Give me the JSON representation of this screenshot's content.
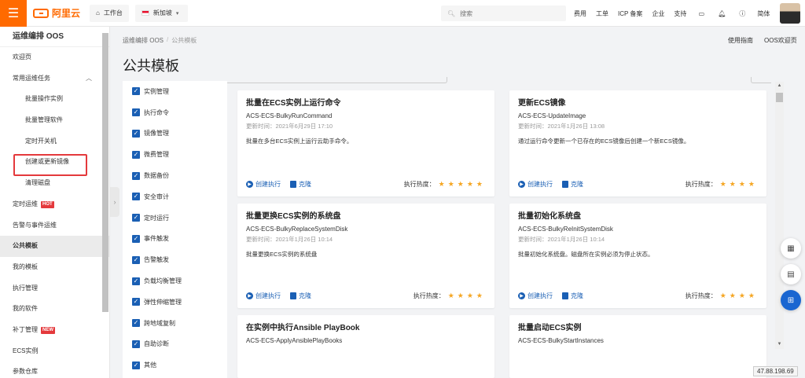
{
  "topbar": {
    "menu_icon": "hamburger-icon",
    "logo_text": "阿里云",
    "workbench": "工作台",
    "region": "新加坡",
    "search_placeholder": "搜索",
    "links": [
      "费用",
      "工单",
      "ICP 备案",
      "企业",
      "支持"
    ],
    "lang": "简体"
  },
  "sidebar": {
    "title": "运维编排 OOS",
    "items": [
      {
        "label": "欢迎页"
      },
      {
        "label": "常用运维任务"
      },
      {
        "label": "批量操作实例"
      },
      {
        "label": "批量管理软件"
      },
      {
        "label": "定时开关机"
      },
      {
        "label": "创建或更新镜像"
      },
      {
        "label": "清理磁盘"
      },
      {
        "label": "定时运维",
        "badge": "HOT"
      },
      {
        "label": "告警与事件运维"
      },
      {
        "label": "公共模板"
      },
      {
        "label": "我的模板"
      },
      {
        "label": "执行管理"
      },
      {
        "label": "我的软件"
      },
      {
        "label": "补丁管理",
        "badge": "NEW"
      },
      {
        "label": "ECS实例"
      },
      {
        "label": "参数仓库"
      }
    ]
  },
  "breadcrumb": {
    "parent": "运维编排 OOS",
    "sep": "/",
    "current": "公共模板"
  },
  "top_links": [
    "使用指南",
    "OOS欢迎页"
  ],
  "page_title": "公共模板",
  "filters": [
    "实例管理",
    "执行命令",
    "镜像管理",
    "微费管理",
    "数据备份",
    "安全审计",
    "定时运行",
    "事件触发",
    "告警触发",
    "负载均衡管理",
    "弹性伸缩管理",
    "跨地域复制",
    "自助诊断",
    "其他"
  ],
  "cards": [
    {
      "title": "批量在ECS实例上运行命令",
      "id": "ACS-ECS-BulkyRunCommand",
      "time": "更新时间：2021年6月29日 17:10",
      "desc": "批量在多台ECS实例上运行云助手命令。",
      "run": "创建执行",
      "clone": "克隆",
      "heat": "执行热度：",
      "stars": 5
    },
    {
      "title": "更新ECS镜像",
      "id": "ACS-ECS-UpdateImage",
      "time": "更新时间：2021年1月26日 13:08",
      "desc": "通过运行命令更新一个已存在的ECS镜像后创建一个新ECS镜像。",
      "run": "创建执行",
      "clone": "克隆",
      "heat": "执行热度：",
      "stars": 4
    },
    {
      "title": "批量更换ECS实例的系统盘",
      "id": "ACS-ECS-BulkyReplaceSystemDisk",
      "time": "更新时间：2021年1月26日 10:14",
      "desc": "批量更换ECS实例的系统盘",
      "run": "创建执行",
      "clone": "克隆",
      "heat": "执行热度：",
      "stars": 4
    },
    {
      "title": "批量初始化系统盘",
      "id": "ACS-ECS-BulkyReInitSystemDisk",
      "time": "更新时间：2021年1月26日 10:14",
      "desc": "批量初始化系统盘。磁盘所在实例必须为停止状态。",
      "run": "创建执行",
      "clone": "克隆",
      "heat": "执行热度：",
      "stars": 4
    },
    {
      "title": "在实例中执行Ansible PlayBook",
      "id": "ACS-ECS-ApplyAnsiblePlayBooks",
      "time": "",
      "desc": "",
      "run": "",
      "clone": "",
      "heat": "",
      "stars": 0
    },
    {
      "title": "批量启动ECS实例",
      "id": "ACS-ECS-BulkyStartInstances",
      "time": "",
      "desc": "",
      "run": "",
      "clone": "",
      "heat": "",
      "stars": 0
    }
  ],
  "ip_address": "47.88.198.69",
  "colors": {
    "brand": "#ff6a00",
    "link": "#1a5fb4",
    "star": "#f5a623",
    "hot": "#e4393c"
  }
}
